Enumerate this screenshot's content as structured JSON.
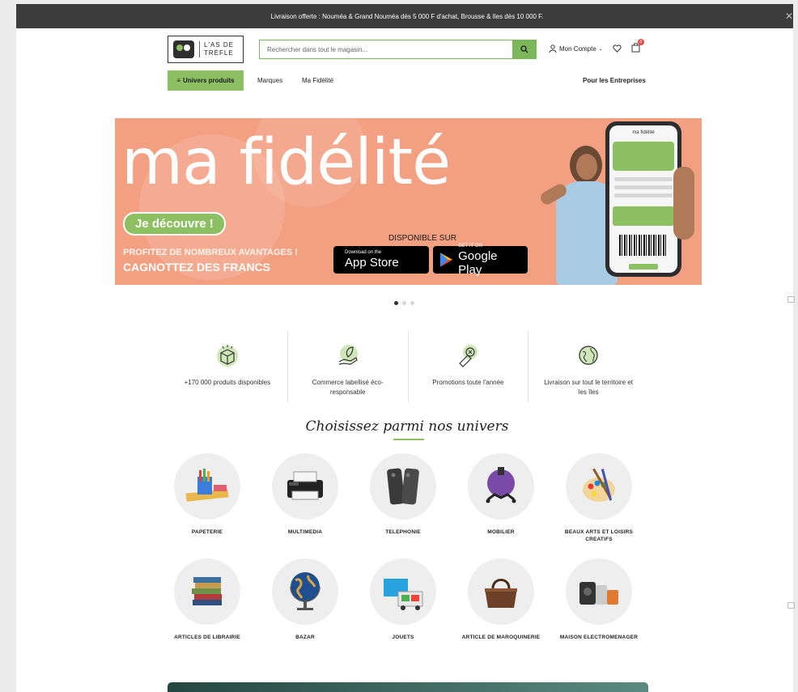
{
  "announcement": {
    "text": "Livraison offerte : Nouméa & Grand Nouméa dès 5 000 F d'achat, Brousse & Iles dès 10 000 F.",
    "close_icon": "close-icon"
  },
  "header": {
    "logo_text": "L'AS DE\nTRÈFLE",
    "logo_mark": "AS",
    "search_placeholder": "Rechercher dans tout le magasin...",
    "account_label": "Mon Compte",
    "cart_count": "0"
  },
  "nav": {
    "products_label": "Univers produits",
    "brands_label": "Marques",
    "loyalty_label": "Ma Fidélité",
    "business_label": "Pour les Entreprises"
  },
  "banner": {
    "brand": "ma fidélité",
    "cta": "Je découvre !",
    "line1": "PROFITEZ DE NOMBREUX AVANTAGES !",
    "line2": "CAGNOTTEZ DES FRANCS",
    "available": "DISPONIBLE SUR",
    "appstore_small": "Download on the",
    "appstore_big": "App Store",
    "googleplay_small": "GET IT ON",
    "googleplay_big": "Google Play",
    "phone_brand": "ma fidélité",
    "slides": 3,
    "active_slide": 1
  },
  "features": [
    {
      "icon": "box-icon",
      "label": "+170 000 produits disponibles"
    },
    {
      "icon": "eco-hand-icon",
      "label": "Commerce labellisé éco-responsable"
    },
    {
      "icon": "promo-tag-icon",
      "label": "Promotions toute l'année"
    },
    {
      "icon": "globe-delivery-icon",
      "label": "Livraison sur tout le territoire et les îles"
    }
  ],
  "categories_heading": "Choisissez parmi nos univers",
  "categories": [
    {
      "label": "PAPETERIE",
      "icon": "stationery-icon"
    },
    {
      "label": "MULTIMEDIA",
      "icon": "printer-icon"
    },
    {
      "label": "TELEPHONIE",
      "icon": "phone-icon"
    },
    {
      "label": "MOBILIER",
      "icon": "chair-icon"
    },
    {
      "label": "BEAUX ARTS ET LOISIRS CREATIFS",
      "icon": "paint-palette-icon"
    },
    {
      "label": "ARTICLES DE LIBRAIRIE",
      "icon": "books-icon"
    },
    {
      "label": "BAZAR",
      "icon": "globe-icon"
    },
    {
      "label": "JOUETS",
      "icon": "toy-icon"
    },
    {
      "label": "ARTICLE DE MAROQUINERIE",
      "icon": "bag-icon"
    },
    {
      "label": "MAISON ELECTROMENAGER",
      "icon": "appliance-icon"
    }
  ],
  "colors": {
    "accent": "#8cc063",
    "banner": "#f3a082",
    "topbar": "#3c3c3c"
  }
}
